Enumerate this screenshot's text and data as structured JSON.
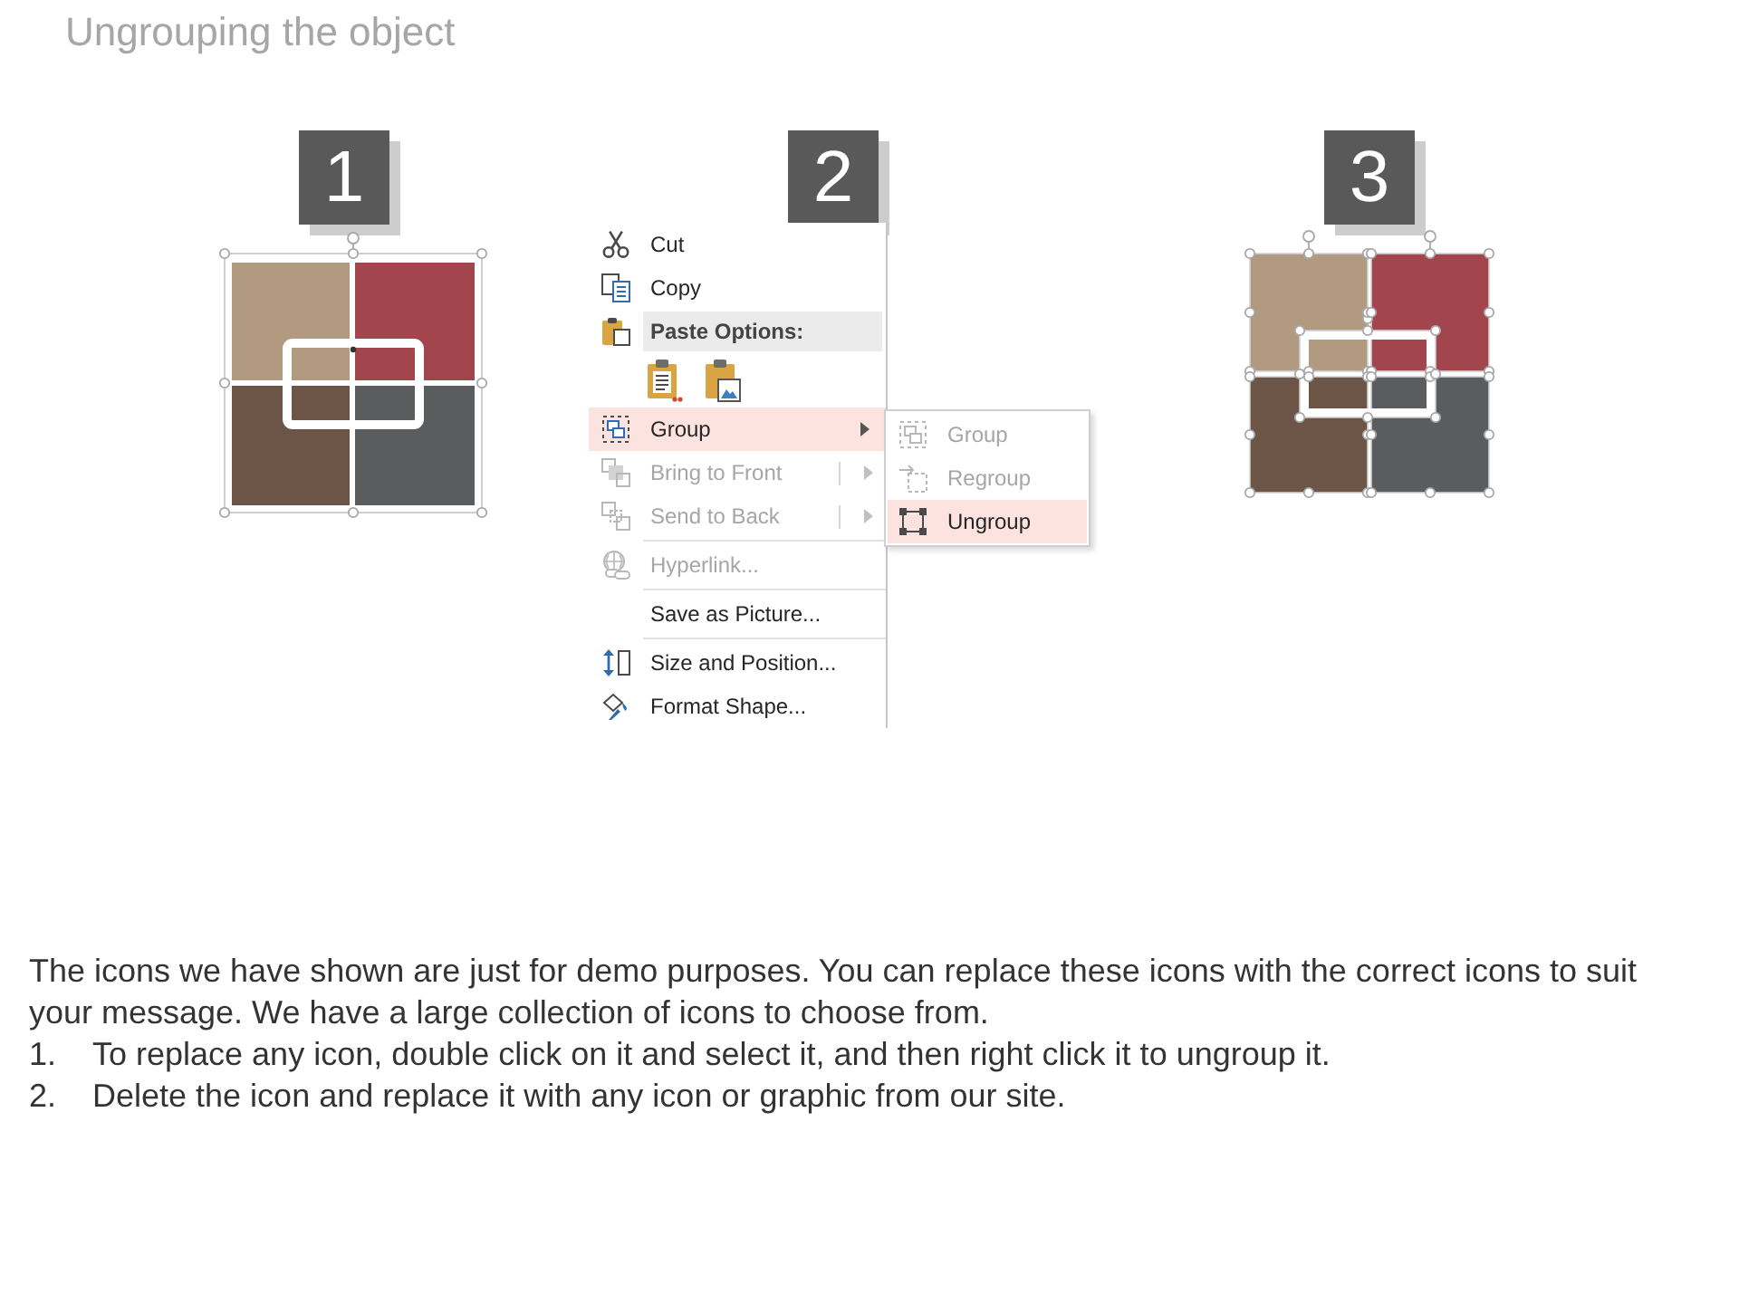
{
  "title": "Ungrouping the object",
  "steps": [
    {
      "number": "1",
      "kind": "grouped"
    },
    {
      "number": "2",
      "kind": "menu",
      "menu": {
        "sections": [
          [
            {
              "kind": "item",
              "label": "Cut",
              "disabled": false,
              "selected": false,
              "has_submenu": false,
              "split": false
            },
            {
              "kind": "item",
              "label": "Copy",
              "disabled": false,
              "selected": false,
              "has_submenu": false,
              "split": false
            },
            {
              "kind": "header",
              "label": "Paste Options:"
            },
            {
              "kind": "paste_buttons"
            },
            {
              "kind": "item",
              "label": "Group",
              "disabled": false,
              "selected": true,
              "has_submenu": true,
              "split": false,
              "submenu": [
                {
                  "label": "Group",
                  "disabled": true,
                  "selected": false
                },
                {
                  "label": "Regroup",
                  "disabled": true,
                  "selected": false
                },
                {
                  "label": "Ungroup",
                  "disabled": false,
                  "selected": true
                }
              ]
            },
            {
              "kind": "item",
              "label": "Bring to Front",
              "disabled": true,
              "selected": false,
              "has_submenu": true,
              "split": true
            },
            {
              "kind": "item",
              "label": "Send to Back",
              "disabled": true,
              "selected": false,
              "has_submenu": true,
              "split": true
            }
          ],
          [
            {
              "kind": "item",
              "label": "Hyperlink...",
              "disabled": true,
              "selected": false,
              "has_submenu": false,
              "split": false
            }
          ],
          [
            {
              "kind": "item",
              "label": "Save as Picture...",
              "disabled": false,
              "selected": false,
              "has_submenu": false,
              "split": false
            }
          ],
          [
            {
              "kind": "item",
              "label": "Size and Position...",
              "disabled": false,
              "selected": false,
              "has_submenu": false,
              "split": false
            },
            {
              "kind": "item",
              "label": "Format Shape...",
              "disabled": false,
              "selected": false,
              "has_submenu": false,
              "split": false
            }
          ]
        ]
      }
    },
    {
      "number": "3",
      "kind": "ungrouped"
    }
  ],
  "description": {
    "text": "The icons we have shown are just for demo purposes. You can replace these icons with the correct icons to suit your message. We have a large collection of icons to choose from.",
    "items": [
      {
        "number": "1.",
        "text": "To replace any icon, double click on it and select it, and then right click it to ungroup it."
      },
      {
        "number": "2.",
        "text": "Delete the icon and replace it with any icon or graphic from our site."
      }
    ]
  }
}
